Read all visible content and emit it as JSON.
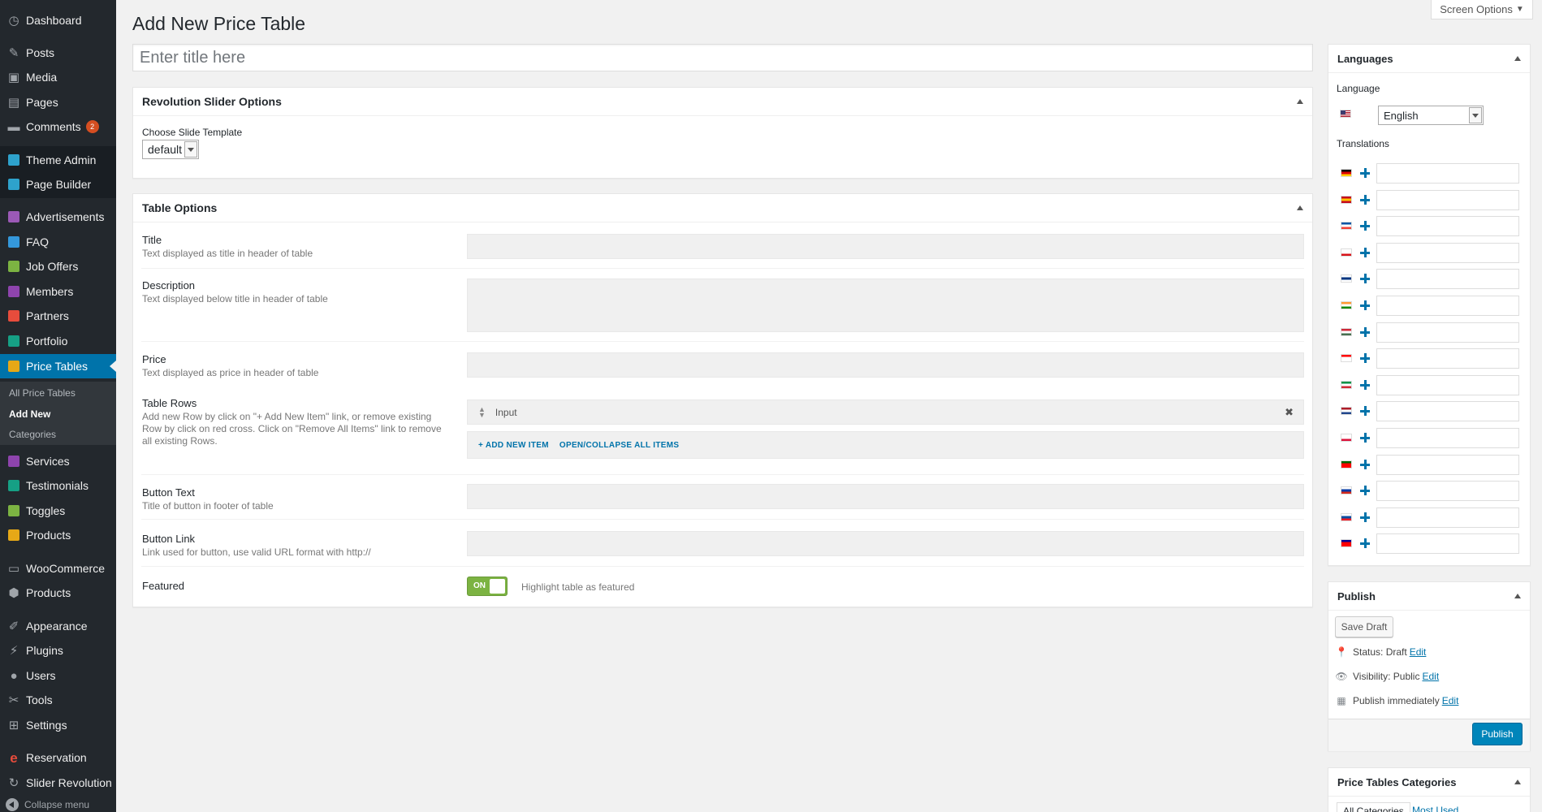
{
  "sidebar": {
    "items": [
      {
        "label": "Dashboard",
        "icon": "dashboard-icon",
        "color": "#a0a5aa"
      },
      {
        "label": "Posts",
        "icon": "pin-icon",
        "color": "#a0a5aa"
      },
      {
        "label": "Media",
        "icon": "media-icon",
        "color": "#a0a5aa"
      },
      {
        "label": "Pages",
        "icon": "page-icon",
        "color": "#a0a5aa"
      },
      {
        "label": "Comments",
        "icon": "comment-icon",
        "color": "#a0a5aa",
        "badge": "2"
      },
      {
        "label": "Theme Admin",
        "icon": "theme-admin-icon",
        "color": "#2ea2cc"
      },
      {
        "label": "Page Builder",
        "icon": "page-builder-icon",
        "color": "#2ea2cc"
      },
      {
        "label": "Advertisements",
        "icon": "advertisements-icon",
        "color": "#9b59b6"
      },
      {
        "label": "FAQ",
        "icon": "faq-icon",
        "color": "#3498db"
      },
      {
        "label": "Job Offers",
        "icon": "job-offers-icon",
        "color": "#7cb342"
      },
      {
        "label": "Members",
        "icon": "members-icon",
        "color": "#8e44ad"
      },
      {
        "label": "Partners",
        "icon": "partners-icon",
        "color": "#e74c3c"
      },
      {
        "label": "Portfolio",
        "icon": "portfolio-icon",
        "color": "#16a085"
      },
      {
        "label": "Price Tables",
        "icon": "price-tables-icon",
        "color": "#e6a817"
      },
      {
        "label": "Services",
        "icon": "services-icon",
        "color": "#8e44ad"
      },
      {
        "label": "Testimonials",
        "icon": "testimonials-icon",
        "color": "#16a085"
      },
      {
        "label": "Toggles",
        "icon": "toggles-icon",
        "color": "#7cb342"
      },
      {
        "label": "Products",
        "icon": "products-icon",
        "color": "#e6a817"
      },
      {
        "label": "WooCommerce",
        "icon": "woocommerce-icon",
        "color": "#a0a5aa"
      },
      {
        "label": "Products",
        "icon": "box-icon",
        "color": "#a0a5aa"
      },
      {
        "label": "Appearance",
        "icon": "brush-icon",
        "color": "#a0a5aa"
      },
      {
        "label": "Plugins",
        "icon": "plug-icon",
        "color": "#a0a5aa"
      },
      {
        "label": "Users",
        "icon": "user-icon",
        "color": "#a0a5aa"
      },
      {
        "label": "Tools",
        "icon": "wrench-icon",
        "color": "#a0a5aa"
      },
      {
        "label": "Settings",
        "icon": "settings-icon",
        "color": "#a0a5aa"
      },
      {
        "label": "Reservation",
        "icon": "reservation-icon",
        "color": "#e74c3c"
      },
      {
        "label": "Slider Revolution",
        "icon": "refresh-icon",
        "color": "#a0a5aa"
      }
    ],
    "submenu": [
      "All Price Tables",
      "Add New",
      "Categories"
    ],
    "collapse_label": "Collapse menu"
  },
  "header": {
    "title": "Add New Price Table",
    "screen_options": "Screen Options"
  },
  "title_field": {
    "placeholder": "Enter title here"
  },
  "revslider": {
    "heading": "Revolution Slider Options",
    "label": "Choose Slide Template",
    "value": "default"
  },
  "table_options": {
    "heading": "Table Options",
    "title_label": "Title",
    "title_desc": "Text displayed as title in header of table",
    "desc_label": "Description",
    "desc_desc": "Text displayed below title in header of table",
    "price_label": "Price",
    "price_desc": "Text displayed as price in header of table",
    "rows_label": "Table Rows",
    "rows_desc": "Add new Row by click on \"+ Add New Item\" link, or remove existing Row by click on red cross. Click on \"Remove All Items\" link to remove all existing Rows.",
    "row_item": "Input",
    "add_item": "+ ADD NEW ITEM",
    "toggle_all": "OPEN/COLLAPSE ALL ITEMS",
    "btn_text_label": "Button Text",
    "btn_text_desc": "Title of button in footer of table",
    "btn_link_label": "Button Link",
    "btn_link_desc": "Link used for button, use valid URL format with http://",
    "featured_label": "Featured",
    "featured_switch": "ON",
    "featured_desc": "Highlight table as featured"
  },
  "languages": {
    "heading": "Languages",
    "language_label": "Language",
    "selected": "English",
    "translations_label": "Translations",
    "flags": [
      {
        "code": "de",
        "colors": [
          "#000000",
          "#dd0000",
          "#ffce00"
        ]
      },
      {
        "code": "es",
        "colors": [
          "#c60b1e",
          "#ffc400",
          "#c60b1e"
        ]
      },
      {
        "code": "fr",
        "colors": [
          "#0055a4",
          "#ffffff",
          "#ef4135"
        ]
      },
      {
        "code": "cz",
        "colors": [
          "#ffffff",
          "#ffffff",
          "#d7141a"
        ]
      },
      {
        "code": "fi",
        "colors": [
          "#ffffff",
          "#003580",
          "#ffffff"
        ]
      },
      {
        "code": "in",
        "colors": [
          "#ff9933",
          "#ffffff",
          "#138808"
        ]
      },
      {
        "code": "hu",
        "colors": [
          "#ce2939",
          "#ffffff",
          "#477050"
        ]
      },
      {
        "code": "id",
        "colors": [
          "#ff0000",
          "#ffffff",
          "#ffffff"
        ]
      },
      {
        "code": "it",
        "colors": [
          "#009246",
          "#ffffff",
          "#ce2b37"
        ]
      },
      {
        "code": "nl",
        "colors": [
          "#ae1c28",
          "#ffffff",
          "#21468b"
        ]
      },
      {
        "code": "pl",
        "colors": [
          "#ffffff",
          "#ffffff",
          "#dc143c"
        ]
      },
      {
        "code": "pt",
        "colors": [
          "#006600",
          "#ff0000",
          "#ff0000"
        ]
      },
      {
        "code": "ru",
        "colors": [
          "#ffffff",
          "#0039a6",
          "#d52b1e"
        ]
      },
      {
        "code": "sk",
        "colors": [
          "#ffffff",
          "#0b4ea2",
          "#ee1c25"
        ]
      },
      {
        "code": "tw",
        "colors": [
          "#000095",
          "#fe0000",
          "#fe0000"
        ]
      }
    ]
  },
  "publish": {
    "heading": "Publish",
    "save_draft": "Save Draft",
    "status_label": "Status: Draft",
    "visibility_label": "Visibility: Public",
    "schedule_label": "Publish immediately",
    "edit": "Edit",
    "publish_btn": "Publish"
  },
  "categories": {
    "heading": "Price Tables Categories",
    "tab_all": "All Categories",
    "tab_used": "Most Used"
  },
  "colors": {
    "sidebar_bg": "#23282d",
    "accent": "#0073aa",
    "switch_on": "#7cb342"
  }
}
